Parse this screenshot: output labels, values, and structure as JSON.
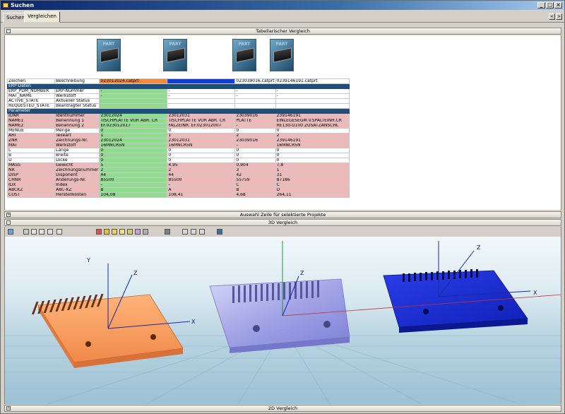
{
  "window": {
    "title": "Suchen"
  },
  "tabs": [
    {
      "label": "Suchen"
    },
    {
      "label": "Vergleichen"
    }
  ],
  "nav": {
    "prev": "<",
    "next": ">"
  },
  "panels": {
    "tabular": "Tabellarischer Vergleich",
    "selection": "Auswahl Zeile für selektierte Projekte",
    "view3d": "3D Vergleich",
    "view2d": "2D Vergleich"
  },
  "thumbnails": [
    {
      "label": "PART"
    },
    {
      "label": "PART"
    },
    {
      "label": "PART"
    },
    {
      "label": "PART"
    }
  ],
  "colors": {
    "section": "#1f4f78",
    "match": "#8fdc8f",
    "diff": "#f0b9b9",
    "orange": "#f08a3a",
    "blue": "#1240d4"
  },
  "table": {
    "header": [
      "Zeichen",
      "Beschreibung",
      "023012024.catprt",
      "",
      "023039016.catprt",
      "0239146191.catprt"
    ],
    "rows": [
      {
        "type": "section",
        "cells": [
          "ERP-Daten"
        ]
      },
      {
        "cells": [
          "ERP_PDM_NUMBER",
          "ERP-Nummer",
          "-",
          "-",
          "-",
          "-"
        ],
        "colors": [
          "w",
          "w",
          "g",
          "w",
          "w",
          "w"
        ]
      },
      {
        "cells": [
          "MAT_NAME",
          "Werkstoff",
          "-",
          "-",
          "-",
          "-"
        ],
        "colors": [
          "w",
          "w",
          "g",
          "w",
          "w",
          "w"
        ]
      },
      {
        "cells": [
          "ACTIVE_STATE",
          "Aktueller Status",
          "",
          "",
          "",
          ""
        ],
        "colors": [
          "w",
          "w",
          "g",
          "w",
          "w",
          "w"
        ]
      },
      {
        "cells": [
          "REQUESTED_STATE",
          "Beantragter Status",
          "",
          "",
          "",
          ""
        ],
        "colors": [
          "w",
          "w",
          "g",
          "w",
          "w",
          "w"
        ]
      },
      {
        "type": "section",
        "cells": [
          "Parameter"
        ]
      },
      {
        "cells": [
          "IDNR",
          "Identnummer",
          "23012024",
          "23012031",
          "23039016",
          "239146191"
        ],
        "colors": [
          "p",
          "p",
          "g",
          "p",
          "p",
          "p"
        ]
      },
      {
        "cells": [
          "NAME1",
          "Benennung 1",
          "TISCHPLATTE VOR ABR.   CR",
          "TISCHPLATTE VOR ABR.   CR",
          "PLATTE",
          "EINLEGESEGM.V.SPALTEINH.CR"
        ],
        "colors": [
          "p",
          "p",
          "g",
          "p",
          "p",
          "p"
        ]
      },
      {
        "cells": [
          "NAME2",
          "Benennung 2",
          "EF.023012017",
          "FALZEINR.   EF.023012007",
          "-",
          "RE130-U100 ZUSATZANSCHL"
        ],
        "colors": [
          "p",
          "p",
          "g",
          "p",
          "p",
          "p"
        ]
      },
      {
        "cells": [
          "MENGE",
          "Menge",
          "0",
          "0",
          "0",
          "0"
        ],
        "colors": [
          "w",
          "w",
          "g",
          "w",
          "w",
          "w"
        ]
      },
      {
        "cells": [
          "ART",
          "Teileart",
          "1",
          "1",
          "2",
          "2"
        ],
        "colors": [
          "p",
          "p",
          "g",
          "p",
          "p",
          "p"
        ]
      },
      {
        "cells": [
          "ZNR",
          "Zeichnungs-Nr.",
          "23012024",
          "23012031",
          "23039016",
          "239146191"
        ],
        "colors": [
          "p",
          "p",
          "g",
          "p",
          "p",
          "p"
        ]
      },
      {
        "cells": [
          "MAT",
          "Werkstoff",
          "16MNCR5N",
          "16MNCR5N",
          "-",
          "16MNCR5N"
        ],
        "colors": [
          "p",
          "p",
          "g",
          "p",
          "p",
          "p"
        ]
      },
      {
        "cells": [
          "L",
          "Länge",
          "0",
          "0",
          "0",
          "0"
        ],
        "colors": [
          "w",
          "w",
          "g",
          "w",
          "w",
          "w"
        ]
      },
      {
        "cells": [
          "B",
          "Breite",
          "0",
          "0",
          "0",
          "0"
        ],
        "colors": [
          "w",
          "w",
          "g",
          "w",
          "w",
          "w"
        ]
      },
      {
        "cells": [
          "D",
          "Dicke",
          "0",
          "0",
          "0",
          "0"
        ],
        "colors": [
          "w",
          "w",
          "g",
          "w",
          "w",
          "w"
        ]
      },
      {
        "cells": [
          "MASS",
          "Gewicht",
          "5",
          "4,95",
          "0,904",
          "7,8"
        ],
        "colors": [
          "p",
          "p",
          "g",
          "p",
          "p",
          "p"
        ]
      },
      {
        "cells": [
          "NR",
          "Zeichnungsnummer",
          "2",
          "2",
          "3",
          "1"
        ],
        "colors": [
          "p",
          "p",
          "g",
          "p",
          "p",
          "p"
        ]
      },
      {
        "cells": [
          "DISP",
          "Disponent",
          "44",
          "44",
          "42",
          "31"
        ],
        "colors": [
          "p",
          "p",
          "g",
          "p",
          "p",
          "p"
        ]
      },
      {
        "cells": [
          "CHNR",
          "Änderungs-Nr.",
          "85500",
          "85500",
          "55759",
          "87186"
        ],
        "colors": [
          "p",
          "p",
          "g",
          "p",
          "p",
          "p"
        ]
      },
      {
        "cells": [
          "IDX",
          "Index",
          "-",
          "-",
          "C",
          "C"
        ],
        "colors": [
          "p",
          "p",
          "g",
          "p",
          "p",
          "p"
        ]
      },
      {
        "cells": [
          "ABCKZ",
          "ABC-KZ",
          "B",
          "A",
          "B",
          "D"
        ],
        "colors": [
          "p",
          "p",
          "g",
          "p",
          "p",
          "p"
        ]
      },
      {
        "cells": [
          "COST",
          "Herstellkosten",
          "104,08",
          "108,41",
          "4,68",
          "264,11"
        ],
        "colors": [
          "p",
          "p",
          "g",
          "p",
          "p",
          "p"
        ]
      }
    ]
  },
  "axes": {
    "x": "X",
    "y": "Y",
    "z": "Z"
  }
}
